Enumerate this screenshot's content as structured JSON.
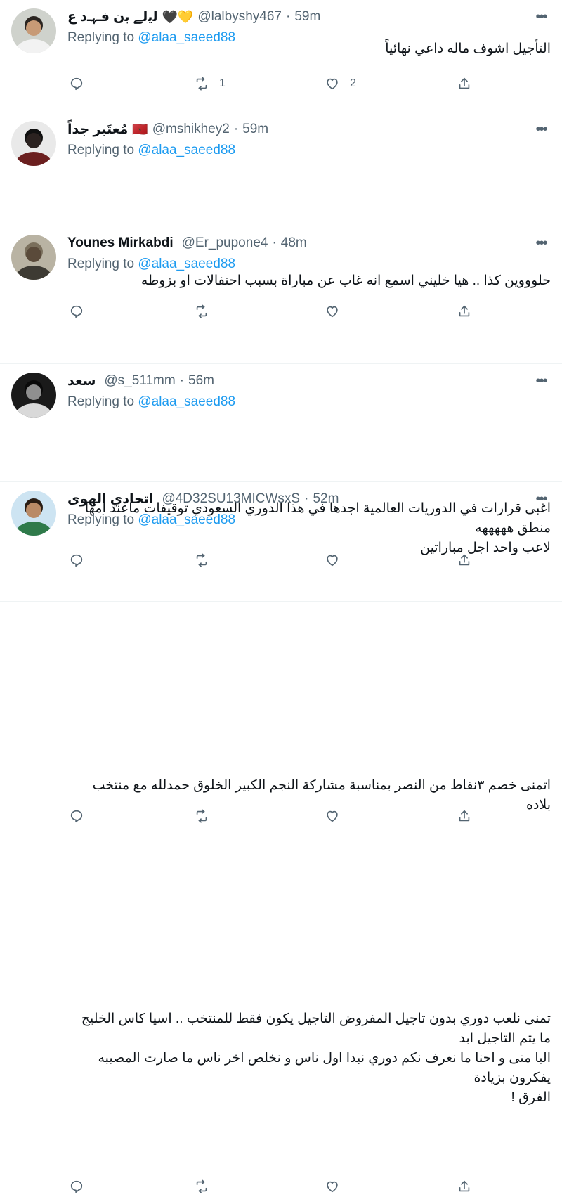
{
  "reply_prefix": "Replying to",
  "tweets": [
    {
      "name": "ﻟﻳﻟﮯ ﺑﻥ ﻓـﮩـﺩ ع",
      "badge": "🖤💛",
      "handle": "@lalbyshy467",
      "time": "59m",
      "reply_to": "@alaa_saeed88",
      "lines": [
        "التأجيل اشوف ماله داعي نهائياً"
      ],
      "replies": "",
      "retweets": "1",
      "likes": "2",
      "avatar": {
        "bg": "#cfd2cc",
        "skin": "#c79a76",
        "cloth": "#f2f2f2",
        "hair": "#2a2420"
      }
    },
    {
      "name": "مُعتَبر جداً",
      "badge": "🇲🇦",
      "handle": "@mshikhey2",
      "time": "59m",
      "reply_to": "@alaa_saeed88",
      "lines": [
        "حلوووين كذا .. هيا خليني اسمع انه غاب عن مباراة بسبب احتفالات او بزوطه"
      ],
      "replies": "",
      "retweets": "",
      "likes": "",
      "avatar": {
        "bg": "#e9e9e9",
        "skin": "#2b2220",
        "cloth": "#6b1f1f",
        "hair": "#111111"
      }
    },
    {
      "name": "Younes Mirkabdi",
      "badge": "",
      "handle": "@Er_pupone4",
      "time": "48m",
      "reply_to": "@alaa_saeed88",
      "lines": [
        "اغبى قرارات في الدوريات العالمية اجدها في هذا الدوري السعودي توقيفات ماعند امها منطق هههههه",
        "لاعب واحد اجل مباراتين"
      ],
      "replies": "",
      "retweets": "",
      "likes": "",
      "avatar": {
        "bg": "#b9b3a3",
        "skin": "#5a4a3a",
        "cloth": "#3d3a33",
        "hair": "#7a6f5c"
      }
    },
    {
      "name": "سعد",
      "badge": "",
      "handle": "@s_511mm",
      "time": "56m",
      "reply_to": "@alaa_saeed88",
      "lines": [
        "اتمنى خصم ٣نقاط من النصر بمناسبة مشاركة النجم الكبير الخلوق حمدلله مع منتخب بلاده"
      ],
      "replies": "",
      "retweets": "",
      "likes": "",
      "avatar": {
        "bg": "#1a1a1a",
        "skin": "#8f8f8f",
        "cloth": "#d9d9d9",
        "hair": "#0a0a0a"
      }
    },
    {
      "name": "اتحادي الهوى",
      "badge": "",
      "handle": "@4D32SU13MICWsxS",
      "time": "52m",
      "reply_to": "@alaa_saeed88",
      "lines": [
        "تمنى نلعب دوري بدون تاجيل المفروض التاجيل يكون فقط للمنتخب .. اسيا كاس الخليج ما يتم التاجيل ابد",
        "اليا متى و احنا ما نعرف نكم دوري نبدا اول ناس و نخلص اخر ناس  ما صارت المصيبه يفكرون بزيادة",
        "الفرق  !"
      ],
      "replies": "",
      "retweets": "",
      "likes": "",
      "avatar": {
        "bg": "#cde4f2",
        "skin": "#b98a66",
        "cloth": "#2f7a4a",
        "hair": "#2a1d14"
      }
    }
  ]
}
